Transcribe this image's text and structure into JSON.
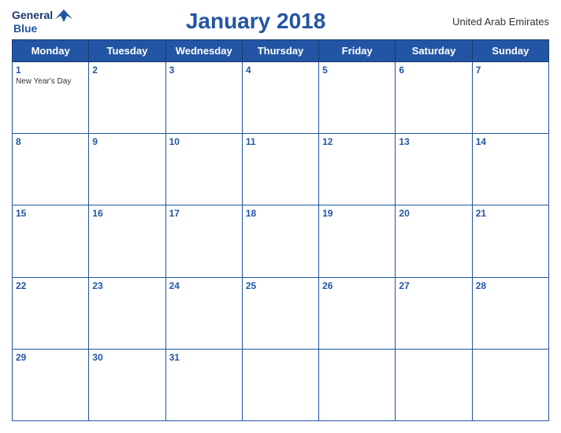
{
  "logo": {
    "general": "General",
    "blue": "Blue",
    "bird_unicode": "▲"
  },
  "header": {
    "title": "January 2018",
    "country": "United Arab Emirates"
  },
  "weekdays": [
    "Monday",
    "Tuesday",
    "Wednesday",
    "Thursday",
    "Friday",
    "Saturday",
    "Sunday"
  ],
  "weeks": [
    [
      {
        "day": "1",
        "holiday": "New Year's Day"
      },
      {
        "day": "2",
        "holiday": ""
      },
      {
        "day": "3",
        "holiday": ""
      },
      {
        "day": "4",
        "holiday": ""
      },
      {
        "day": "5",
        "holiday": ""
      },
      {
        "day": "6",
        "holiday": ""
      },
      {
        "day": "7",
        "holiday": ""
      }
    ],
    [
      {
        "day": "8",
        "holiday": ""
      },
      {
        "day": "9",
        "holiday": ""
      },
      {
        "day": "10",
        "holiday": ""
      },
      {
        "day": "11",
        "holiday": ""
      },
      {
        "day": "12",
        "holiday": ""
      },
      {
        "day": "13",
        "holiday": ""
      },
      {
        "day": "14",
        "holiday": ""
      }
    ],
    [
      {
        "day": "15",
        "holiday": ""
      },
      {
        "day": "16",
        "holiday": ""
      },
      {
        "day": "17",
        "holiday": ""
      },
      {
        "day": "18",
        "holiday": ""
      },
      {
        "day": "19",
        "holiday": ""
      },
      {
        "day": "20",
        "holiday": ""
      },
      {
        "day": "21",
        "holiday": ""
      }
    ],
    [
      {
        "day": "22",
        "holiday": ""
      },
      {
        "day": "23",
        "holiday": ""
      },
      {
        "day": "24",
        "holiday": ""
      },
      {
        "day": "25",
        "holiday": ""
      },
      {
        "day": "26",
        "holiday": ""
      },
      {
        "day": "27",
        "holiday": ""
      },
      {
        "day": "28",
        "holiday": ""
      }
    ],
    [
      {
        "day": "29",
        "holiday": ""
      },
      {
        "day": "30",
        "holiday": ""
      },
      {
        "day": "31",
        "holiday": ""
      },
      {
        "day": "",
        "holiday": ""
      },
      {
        "day": "",
        "holiday": ""
      },
      {
        "day": "",
        "holiday": ""
      },
      {
        "day": "",
        "holiday": ""
      }
    ]
  ]
}
